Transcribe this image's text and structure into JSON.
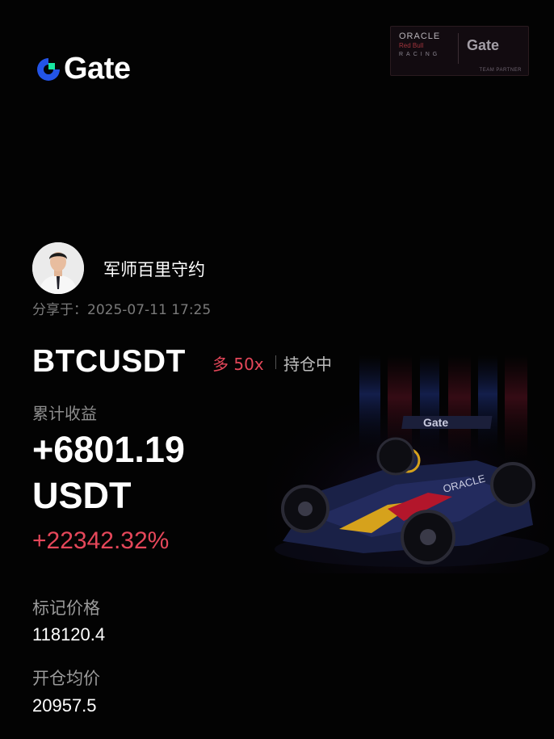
{
  "brand": {
    "name": "Gate",
    "accent": "#2354e6",
    "accent_secondary": "#17e6a1"
  },
  "partner": {
    "oracle": "ORACLE",
    "redbull": "Red Bull",
    "racing": "RACING",
    "gate": "Gate",
    "label": "TEAM PARTNER"
  },
  "user": {
    "name": "军师百里守约",
    "shared_at": "分享于：2025-07-11 17:25"
  },
  "position": {
    "pair": "BTCUSDT",
    "side": "多 50x",
    "status": "持仓中"
  },
  "pnl": {
    "label": "累计收益",
    "value": "+6801.19",
    "unit": "USDT",
    "percent": "+22342.32%"
  },
  "mark_price": {
    "label": "标记价格",
    "value": "118120.4"
  },
  "entry_price": {
    "label": "开仓均价",
    "value": "20957.5"
  },
  "colors": {
    "positive": "#e5475a",
    "muted": "#8e8e8e",
    "background": "#030303"
  }
}
